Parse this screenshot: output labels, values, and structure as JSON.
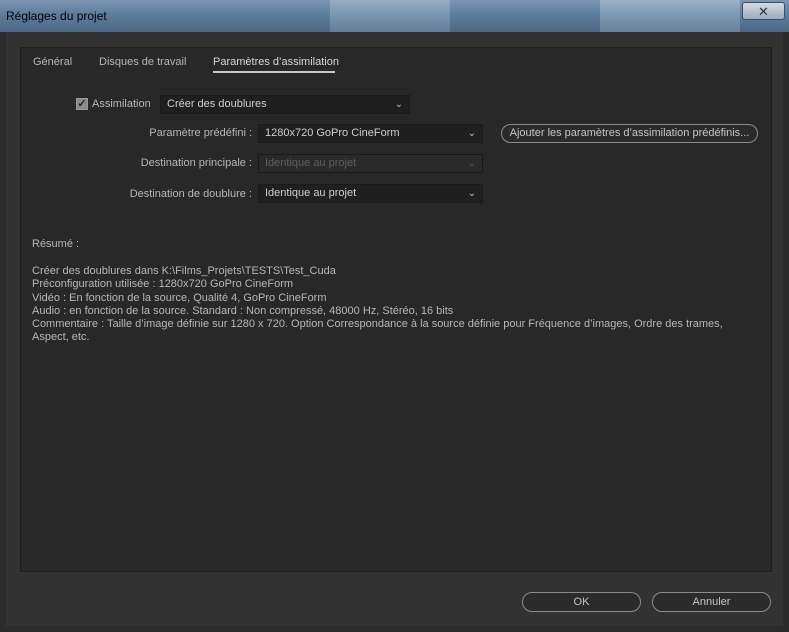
{
  "window": {
    "title": "Réglages du projet",
    "close_glyph": "✕"
  },
  "tabs": [
    {
      "label": "Général"
    },
    {
      "label": "Disques de travail"
    },
    {
      "label": "Paramètres d’assimilation"
    }
  ],
  "ingest": {
    "checkbox_label": "Assimilation",
    "checked": true,
    "mode_value": "Créer des doublures",
    "preset_label": "Paramètre prédéfini :",
    "preset_value": "1280x720 GoPro CineForm",
    "add_preset_button": "Ajouter les paramètres d’assimilation prédéfinis...",
    "primary_dest_label": "Destination principale :",
    "primary_dest_value": "Identique au projet",
    "proxy_dest_label": "Destination de doublure :",
    "proxy_dest_value": "Identique au projet"
  },
  "summary": {
    "title": "Résumé :",
    "lines": [
      "Créer des doublures dans K:\\Films_Projets\\TESTS\\Test_Cuda",
      "Préconfiguration  utilisée : 1280x720 GoPro CineForm",
      "Vidéo : En fonction de la source, Qualité  4, GoPro CineForm",
      "Audio : en fonction de la source. Standard : Non compressé, 48000  Hz, Stéréo, 16 bits",
      "Commentaire : Taille d’image définie sur 1280 x 720. Option Correspondance à la source définie pour Fréquence d’images, Ordre des trames,",
      "Aspect, etc."
    ]
  },
  "footer": {
    "ok_label": "OK",
    "cancel_label": "Annuler"
  },
  "icons": {
    "dropdown": "chevron-down-icon",
    "check": "check-icon"
  }
}
